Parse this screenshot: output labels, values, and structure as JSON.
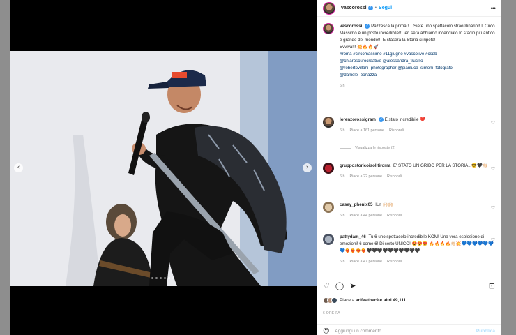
{
  "header": {
    "username": "vascorossi",
    "separator": "•",
    "follow": "Segui",
    "more": "•••"
  },
  "caption": {
    "username": "vascorossi",
    "text": "Pazzesca la prima!! ...Siete uno spettacolo straordinario!! Il Circo Massimo è un posto incredibile!!! Ieri sera abbiamo incendiato lo stadio più antico e grande del mondo!!! E stasera la Storia si ripete!",
    "text2": "Evviva!!! 💥🔥🔥🚀",
    "hashtags": "#roma #circomassimo #11giugno #vascolive #csdb",
    "tags_line1": "@chiaroscurocreative @alessandra_trucillo",
    "tags_line2": "@robertovillani_photographer @gianluca_simoni_fotografo",
    "tags_line3": "@daniele_bonazza",
    "time": "6 h"
  },
  "comments": [
    {
      "username": "lorenzorossigram",
      "text": "È stato incredibile ❤️",
      "time": "6 h",
      "likes": "Piace a 161 persone",
      "reply": "Rispondi",
      "replies": "Visualizza le risposte (2)"
    },
    {
      "username": "gruppostoricoisolitiroma",
      "text": "E' STATO UN GRIDO PER LA STORIA.. 😎🖤👏🏻",
      "time": "6 h",
      "likes": "Piace a 22 persone",
      "reply": "Rispondi"
    },
    {
      "username": "casey_phenix05",
      "text": "ILY 🙌🏻🙌🏻",
      "time": "6 h",
      "likes": "Piace a 44 persone",
      "reply": "Rispondi"
    },
    {
      "username": "pattydam_46",
      "text": "Tu 6 uno spettacolo incredibile KOM! Una vera esplosione di emozioni! 6 come 6! Di certo UNICO! 😍😍😍 🔥🔥🔥🔥👏🏻💥💙💙💙💙💙💙💙❤️‍🔥❤️‍🔥❤️‍🔥❤️‍🔥🖤🖤🖤🖤🖤🖤🖤🖤🖤🖤",
      "time": "6 h",
      "likes": "Piace a 47 persone",
      "reply": "Rispondi"
    }
  ],
  "actions": {
    "like": "♡",
    "comment": "◯",
    "share": "➤",
    "save": "⊡"
  },
  "likes": {
    "prefix": "Piace a ",
    "user": "arifeather9",
    "suffix": " e altri 49,111"
  },
  "post_time": "6 ORE FA",
  "add_comment": {
    "emoji": "☺",
    "placeholder": "Aggiungi un commento...",
    "publish": "Pubblica"
  },
  "nav": {
    "prev": "‹",
    "next": "›"
  },
  "carousel": {
    "total": 6,
    "active": 4
  }
}
